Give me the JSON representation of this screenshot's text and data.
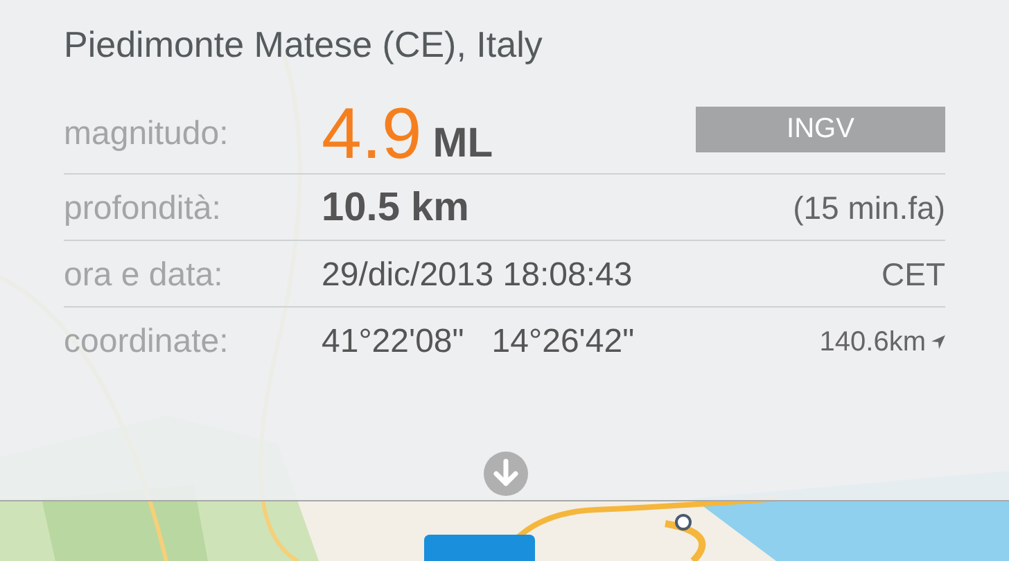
{
  "location": "Piedimonte Matese (CE), Italy",
  "rows": [
    {
      "kind": "magnitude",
      "label": "magnitudo:",
      "value": "4.9",
      "unit": "ML",
      "extra": "INGV"
    },
    {
      "kind": "plain",
      "label": "profondità:",
      "value": "10.5 km",
      "extra": "(15 min.fa)",
      "bold": true
    },
    {
      "kind": "plain",
      "label": "ora e data:",
      "value": "29/dic/2013 18:08:43",
      "extra": "CET",
      "bold": false
    },
    {
      "kind": "coords",
      "label": "coordinate:",
      "lat": "41°22'08\"",
      "lon": "14°26'42\"",
      "extra": "140.6km"
    }
  ]
}
